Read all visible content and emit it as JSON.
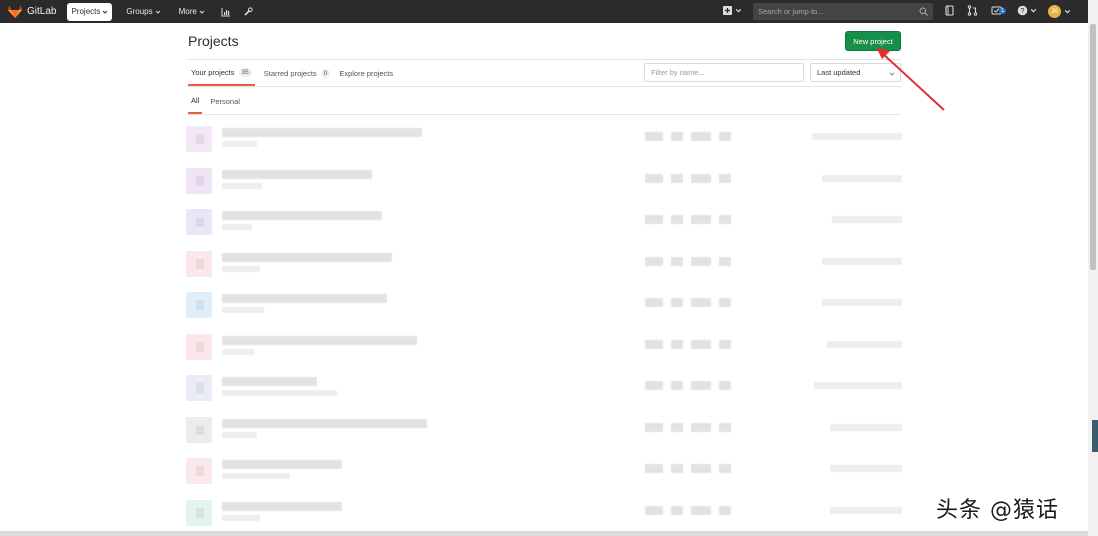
{
  "navbar": {
    "brand": "GitLab",
    "menus": [
      {
        "label": "Projects",
        "active": true
      },
      {
        "label": "Groups",
        "active": false
      },
      {
        "label": "More",
        "active": false
      }
    ],
    "icons": [
      "activity-chart-icon",
      "admin-wrench-icon"
    ],
    "search_placeholder": "Search or jump to...",
    "todo_count": "1",
    "avatar_initials": "JK"
  },
  "page": {
    "title": "Projects",
    "new_project_label": "New project"
  },
  "tabs": [
    {
      "label": "Your projects",
      "count": "35",
      "active": true
    },
    {
      "label": "Starred projects",
      "count": "0",
      "active": false
    },
    {
      "label": "Explore projects",
      "count": null,
      "active": false
    }
  ],
  "filter": {
    "placeholder": "Filter by name...",
    "sort_selected": "Last updated"
  },
  "subtabs": [
    {
      "label": "All",
      "active": true
    },
    {
      "label": "Personal",
      "active": false
    }
  ],
  "projects": [
    {
      "avatar_color": "#f3e6f7"
    },
    {
      "avatar_color": "#efe4f6"
    },
    {
      "avatar_color": "#e7e7f7"
    },
    {
      "avatar_color": "#fbe7ea"
    },
    {
      "avatar_color": "#e0eefa"
    },
    {
      "avatar_color": "#fbe7ea"
    },
    {
      "avatar_color": "#e9ebf7"
    },
    {
      "avatar_color": "#ececec"
    },
    {
      "avatar_color": "#fbe8ea"
    },
    {
      "avatar_color": "#e3f3f0"
    }
  ],
  "colors": {
    "navbar_bg": "#2b2b2b",
    "primary_green": "#168f48",
    "active_tab_underline": "#e75e40",
    "annotation_arrow": "#e03030"
  },
  "watermark": "头条 @猿话"
}
